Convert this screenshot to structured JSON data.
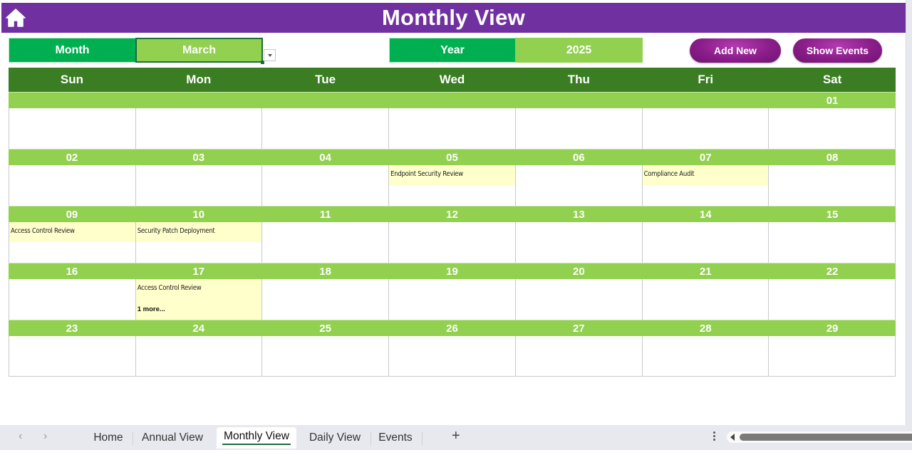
{
  "header": {
    "title": "Monthly View",
    "home_icon": "home-icon"
  },
  "controls": {
    "month_label": "Month",
    "month_value": "March",
    "year_label": "Year",
    "year_value": "2025",
    "add_new": "Add New",
    "show_events": "Show Events"
  },
  "colors": {
    "banner": "#7030a0",
    "label_green": "#00b050",
    "value_green": "#92d050",
    "dow_green": "#3a7d22",
    "event_bg": "#ffffcc",
    "button_purple": "#8b1d8a"
  },
  "calendar": {
    "days_of_week": [
      "Sun",
      "Mon",
      "Tue",
      "Wed",
      "Thu",
      "Fri",
      "Sat"
    ],
    "weeks": [
      {
        "dates": [
          "",
          "",
          "",
          "",
          "",
          "",
          "01"
        ],
        "events": [
          "",
          "",
          "",
          "",
          "",
          "",
          ""
        ],
        "more": [
          "",
          "",
          "",
          "",
          "",
          "",
          ""
        ]
      },
      {
        "dates": [
          "02",
          "03",
          "04",
          "05",
          "06",
          "07",
          "08"
        ],
        "events": [
          "",
          "",
          "",
          "Endpoint Security Review",
          "",
          "Compliance Audit",
          ""
        ],
        "more": [
          "",
          "",
          "",
          "",
          "",
          "",
          ""
        ]
      },
      {
        "dates": [
          "09",
          "10",
          "11",
          "12",
          "13",
          "14",
          "15"
        ],
        "events": [
          "Access Control Review",
          "Security Patch Deployment",
          "",
          "",
          "",
          "",
          ""
        ],
        "more": [
          "",
          "",
          "",
          "",
          "",
          "",
          ""
        ]
      },
      {
        "dates": [
          "16",
          "17",
          "18",
          "19",
          "20",
          "21",
          "22"
        ],
        "events": [
          "",
          "Access Control Review",
          "",
          "",
          "",
          "",
          ""
        ],
        "more": [
          "",
          "1 more...",
          "",
          "",
          "",
          "",
          ""
        ]
      },
      {
        "dates": [
          "23",
          "24",
          "25",
          "26",
          "27",
          "28",
          "29"
        ],
        "events": [
          "",
          "",
          "",
          "",
          "",
          "",
          ""
        ],
        "more": [
          "",
          "",
          "",
          "",
          "",
          "",
          ""
        ]
      }
    ]
  },
  "sheet_tabs": {
    "prev_icon": "chevron-left-icon",
    "next_icon": "chevron-right-icon",
    "tabs": [
      "Home",
      "Annual View",
      "Monthly View",
      "Daily View",
      "Events"
    ],
    "active": "Monthly View",
    "add_label": "+"
  }
}
